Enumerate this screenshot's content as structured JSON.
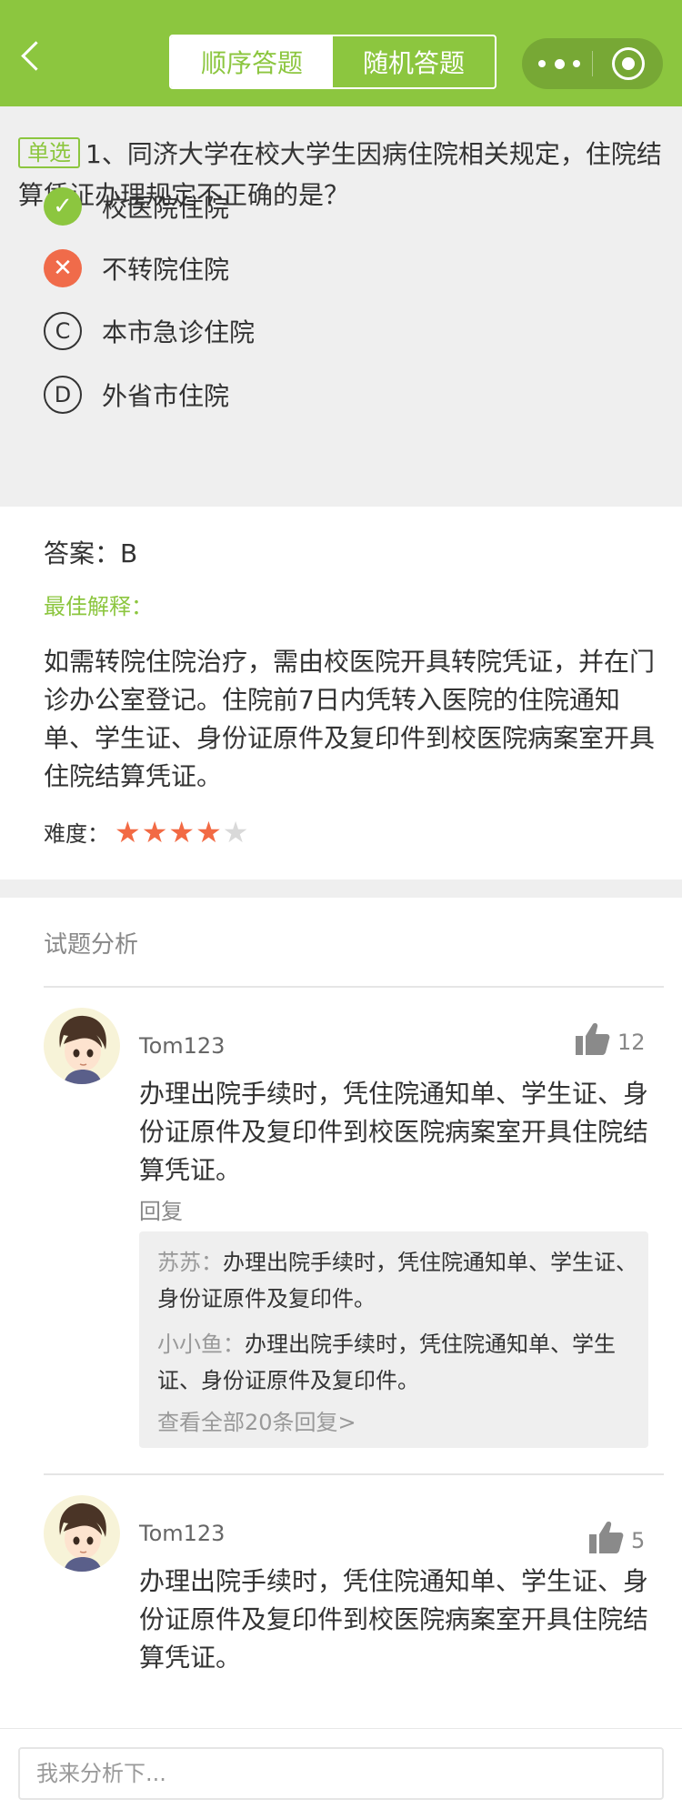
{
  "header": {
    "tabs": [
      {
        "label": "顺序答题",
        "active": true
      },
      {
        "label": "随机答题",
        "active": false
      }
    ],
    "accent_color": "#8cc63f"
  },
  "question": {
    "type_badge": "单选",
    "text": "1、同济大学在校大学生因病住院相关规定，住院结算凭证办理规定不正确的是？",
    "options": [
      {
        "marker": "✓",
        "state": "correct",
        "label": "校医院住院"
      },
      {
        "marker": "✕",
        "state": "wrong",
        "label": "不转院住院"
      },
      {
        "marker": "C",
        "state": "plain",
        "label": "本市急诊住院"
      },
      {
        "marker": "D",
        "state": "plain",
        "label": "外省市住院"
      }
    ]
  },
  "answer": {
    "label": "答案：B",
    "best_label": "最佳解释：",
    "explanation": "如需转院住院治疗，需由校医院开具转院凭证，并在门诊办公室登记。住院前7日内凭转入医院的住院通知单、学生证、身份证原件及复印件到校医院病案室开具住院结算凭证。",
    "difficulty_label": "难度：",
    "difficulty_rating": 4,
    "difficulty_max": 5
  },
  "analysis": {
    "title": "试题分析",
    "comments": [
      {
        "user": "Tom123",
        "likes": "12",
        "body": "办理出院手续时，凭住院通知单、学生证、身份证原件及复印件到校医院病案室开具住院结算凭证。",
        "reply_label": "回复",
        "replies": [
          {
            "name": "苏苏：",
            "text": "办理出院手续时，凭住院通知单、学生证、身份证原件及复印件。"
          },
          {
            "name": "小小鱼：",
            "text": "办理出院手续时，凭住院通知单、学生证、身份证原件及复印件。"
          }
        ],
        "more": "查看全部20条回复>"
      },
      {
        "user": "Tom123",
        "likes": "5",
        "body": "办理出院手续时，凭住院通知单、学生证、身份证原件及复印件到校医院病案室开具住院结算凭证。"
      }
    ]
  },
  "input": {
    "placeholder": "我来分析下..."
  }
}
